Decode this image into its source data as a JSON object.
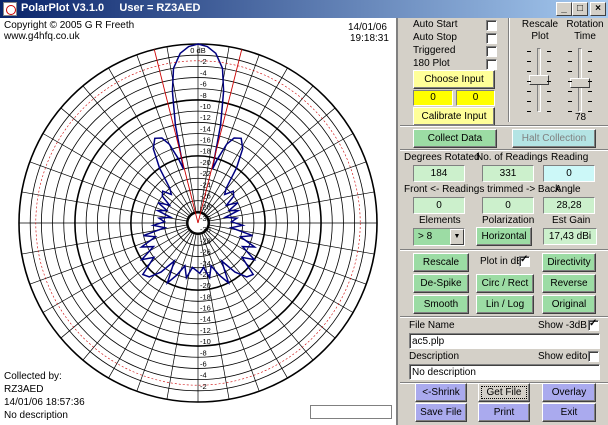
{
  "window": {
    "title": "PolarPlot V3.1.0     User = RZ3AED",
    "minimize_glyph": "_",
    "maximize_glyph": "□",
    "close_glyph": "×"
  },
  "plot": {
    "copyright": "Copyright © 2005 G R Freeth",
    "website": "www.g4hfq.co.uk",
    "date": "14/01/06",
    "time": "19:18:31",
    "collected_by_label": "Collected by:",
    "collector": "RZ3AED",
    "collected_at": "14/01/06 18:57:36",
    "description": "No description",
    "db_labels": [
      "0 dB",
      "-2",
      "-4",
      "-6",
      "-8",
      "-10",
      "-12",
      "-14",
      "-16",
      "-18",
      "-20",
      "-22",
      "-24",
      "-26",
      "-28",
      "-30"
    ]
  },
  "controls": {
    "auto_start": {
      "label": "Auto Start",
      "checked": false
    },
    "auto_stop": {
      "label": "Auto Stop",
      "checked": false
    },
    "triggered": {
      "label": "Triggered",
      "checked": false
    },
    "plot_180": {
      "label": "180 Plot",
      "checked": false
    },
    "rescale_plot_label": "Rescale Plot",
    "rotation_time_label": "Rotation Time",
    "rescale_plot_level": 0.5,
    "rotation_time_level": 0.55,
    "rotation_time_value": "78",
    "choose_input": "Choose Input",
    "input_left": "0",
    "input_right": "0",
    "calibrate_input": "Calibrate Input",
    "collect_data": "Collect Data",
    "halt_collection": "Halt Collection"
  },
  "readings": {
    "degrees_rotated_label": "Degrees Rotated",
    "degrees_rotated": "184",
    "no_of_readings_label": "No. of Readings",
    "no_of_readings": "331",
    "reading_label": "Reading",
    "reading": "0",
    "trimmed_label": "Front <- Readings trimmed -> Back",
    "trim_front": "0",
    "trim_back": "0",
    "angle_label": "Angle",
    "angle": "28,28",
    "elements_label": "Elements",
    "elements": "> 8",
    "polarization_label": "Polarization",
    "polarization": "Horizontal",
    "est_gain_label": "Est Gain",
    "est_gain": "17,43 dBi"
  },
  "actions": {
    "rescale": "Rescale",
    "plot_in_db": {
      "label": "Plot in dB",
      "checked": true
    },
    "directivity": "Directivity",
    "despike": "De-Spike",
    "circ_rect": "Circ / Rect",
    "reverse": "Reverse",
    "smooth": "Smooth",
    "lin_log": "Lin / Log",
    "original": "Original"
  },
  "file": {
    "file_name_label": "File Name",
    "show_3db": {
      "label": "Show -3dB",
      "checked": true
    },
    "file_name": "ac5.plp",
    "description_label": "Description",
    "show_editor": {
      "label": "Show editor",
      "checked": false
    },
    "description": "No description"
  },
  "bottom_buttons": {
    "shrink": "<-Shrink",
    "get_file": "Get File",
    "overlay": "Overlay",
    "save_file": "Save File",
    "print": "Print",
    "exit": "Exit"
  },
  "colors": {
    "title_start": "#0a246a",
    "title_end": "#a6caf0",
    "pattern": "#000080",
    "beamwidth": "#cc0000",
    "green_button": "#9cdca4",
    "purple_button": "#aaaaee",
    "yellow_field": "#ffff00"
  }
}
